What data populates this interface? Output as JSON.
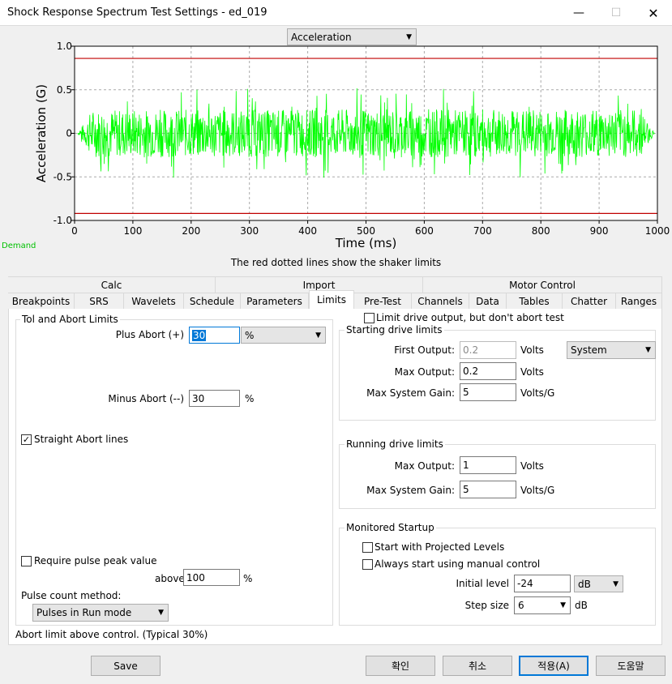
{
  "window": {
    "title": "Shock Response Spectrum Test Settings - ed_019"
  },
  "chart_select": {
    "value": "Acceleration"
  },
  "demand_label": "Demand",
  "chart_data": {
    "type": "line",
    "ylabel": "Acceleration (G)",
    "xlabel": "Time (ms)",
    "xlim": [
      0,
      1000
    ],
    "ylim": [
      -1.0,
      1.0
    ],
    "x_ticks": [
      "0",
      "100",
      "200",
      "300",
      "400",
      "500",
      "600",
      "700",
      "800",
      "900",
      "1000"
    ],
    "y_ticks": [
      "1.0",
      "0.5",
      "0",
      "-0.5",
      "-1.0"
    ],
    "limits": [
      0.86,
      -0.92
    ],
    "signal": {
      "name": "Demand",
      "start_ms": 5,
      "end_ms": 995,
      "peak": 0.62,
      "color": "#00ff00"
    },
    "limit_color": "#c00000",
    "grid": true
  },
  "chart_note": "The red dotted lines show the shaker limits",
  "tabs_row1": [
    "Calc",
    "Import",
    "Motor Control"
  ],
  "tabs_row2": [
    "Breakpoints",
    "SRS",
    "Wavelets",
    "Schedule",
    "Parameters",
    "Limits",
    "Pre-Test",
    "Channels",
    "Data",
    "Tables",
    "Chatter",
    "Ranges"
  ],
  "tol": {
    "title": "Tol and Abort Limits",
    "plus_label": "Plus Abort (+)",
    "plus_value": "30",
    "plus_unit": "%",
    "minus_label": "Minus Abort (--)",
    "minus_value": "30",
    "minus_unit": "%",
    "straight_label": "Straight Abort lines",
    "straight_checked": "✓",
    "require_label": "Require pulse peak value",
    "above_label": "above",
    "above_value": "100",
    "above_unit": "%",
    "pulse_method_label": "Pulse count method:",
    "pulse_method_value": "Pulses in Run mode"
  },
  "limit_drive": {
    "label": "Limit drive output, but don't abort test"
  },
  "starting": {
    "title": "Starting drive limits",
    "first_label": "First Output:",
    "first_value": "0.2",
    "first_unit": "Volts",
    "system_value": "System",
    "max_label": "Max Output:",
    "max_value": "0.2",
    "max_unit": "Volts",
    "gain_label": "Max System Gain:",
    "gain_value": "5",
    "gain_unit": "Volts/G"
  },
  "running": {
    "title": "Running drive limits",
    "max_label": "Max Output:",
    "max_value": "1",
    "max_unit": "Volts",
    "gain_label": "Max System Gain:",
    "gain_value": "5",
    "gain_unit": "Volts/G"
  },
  "startup": {
    "title": "Monitored Startup",
    "projected_label": "Start with Projected Levels",
    "manual_label": "Always start using manual control",
    "initial_label": "Initial level",
    "initial_value": "-24",
    "initial_unit": "dB",
    "step_label": "Step size",
    "step_value": "6",
    "step_unit": "dB"
  },
  "status_text": "Abort limit above control. (Typical 30%)",
  "buttons": {
    "save": "Save",
    "ok": "확인",
    "cancel": "취소",
    "apply": "적용(A)",
    "help": "도움말"
  }
}
